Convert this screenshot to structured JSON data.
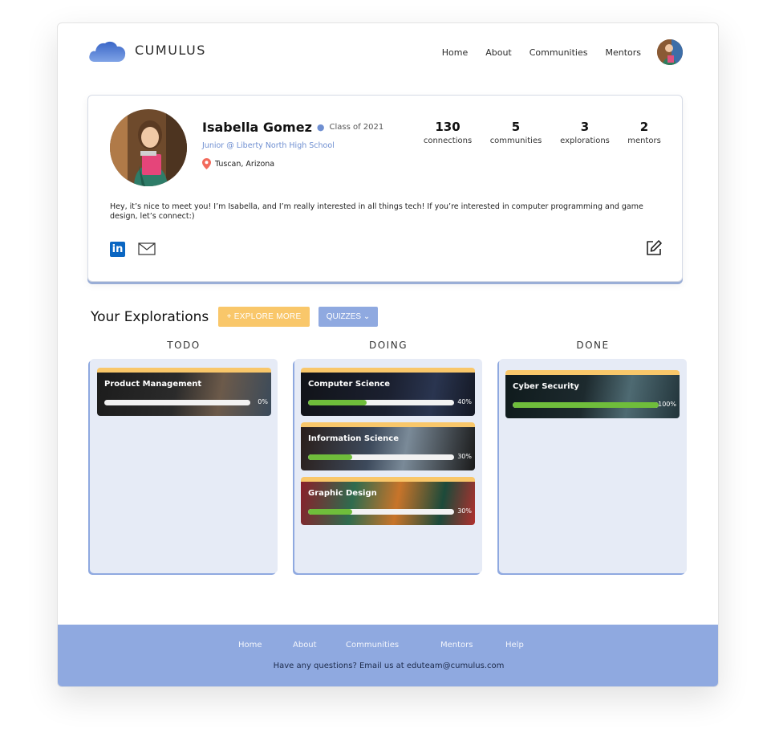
{
  "app": {
    "brand": "CUMULUS"
  },
  "nav": {
    "items": [
      "Home",
      "About",
      "Communities",
      "Mentors"
    ]
  },
  "profile": {
    "name": "Isabella Gomez",
    "class_of": "Class of 2021",
    "school": "Junior @ Liberty North High School",
    "location": "Tuscan, Arizona",
    "stats": [
      {
        "value": "130",
        "label": "connections"
      },
      {
        "value": "5",
        "label": "communities"
      },
      {
        "value": "3",
        "label": "explorations"
      },
      {
        "value": "2",
        "label": "mentors"
      }
    ],
    "bio": "Hey, it’s nice to meet you! I’m Isabella, and I’m really interested in all things tech! If you’re interested in computer programming and game design, let’s connect:)",
    "linkedin_glyph": "in"
  },
  "explorations": {
    "title": "Your Explorations",
    "explore_button": "+ EXPLORE MORE",
    "quizzes_button": "QUIZZES ⌄",
    "columns": [
      {
        "heading": "TODO",
        "cards": [
          {
            "title": "Product Management",
            "progress": 0,
            "progress_label": "0%"
          }
        ]
      },
      {
        "heading": "DOING",
        "cards": [
          {
            "title": "Computer Science",
            "progress": 40,
            "progress_label": "40%"
          },
          {
            "title": "Information Science",
            "progress": 30,
            "progress_label": "30%"
          },
          {
            "title": "Graphic Design",
            "progress": 30,
            "progress_label": "30%"
          }
        ]
      },
      {
        "heading": "DONE",
        "cards": [
          {
            "title": "Cyber Security",
            "progress": 100,
            "progress_label": "100%"
          }
        ]
      }
    ]
  },
  "footer": {
    "links": [
      "Home",
      "About",
      "Communities",
      "Mentors",
      "Help"
    ],
    "contact": "Have any questions? Email us at eduteam@cumulus.com"
  },
  "colors": {
    "accent_blue": "#8fa9e0",
    "accent_yellow": "#f9c76a",
    "progress_green": "#6fbd3b",
    "link_blue": "#6f8fd1"
  }
}
